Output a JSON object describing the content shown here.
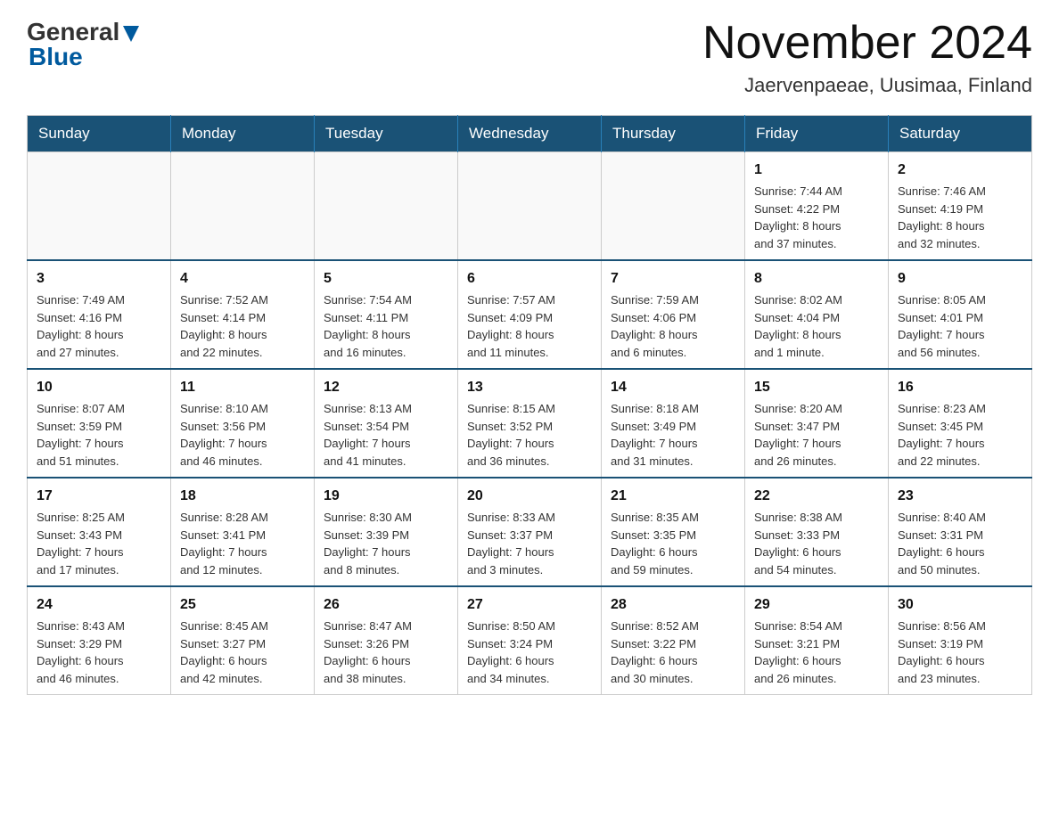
{
  "header": {
    "logo_general": "General",
    "logo_blue": "Blue",
    "month_title": "November 2024",
    "location": "Jaervenpaeae, Uusimaa, Finland"
  },
  "weekdays": [
    "Sunday",
    "Monday",
    "Tuesday",
    "Wednesday",
    "Thursday",
    "Friday",
    "Saturday"
  ],
  "weeks": [
    [
      {
        "day": "",
        "info": ""
      },
      {
        "day": "",
        "info": ""
      },
      {
        "day": "",
        "info": ""
      },
      {
        "day": "",
        "info": ""
      },
      {
        "day": "",
        "info": ""
      },
      {
        "day": "1",
        "info": "Sunrise: 7:44 AM\nSunset: 4:22 PM\nDaylight: 8 hours\nand 37 minutes."
      },
      {
        "day": "2",
        "info": "Sunrise: 7:46 AM\nSunset: 4:19 PM\nDaylight: 8 hours\nand 32 minutes."
      }
    ],
    [
      {
        "day": "3",
        "info": "Sunrise: 7:49 AM\nSunset: 4:16 PM\nDaylight: 8 hours\nand 27 minutes."
      },
      {
        "day": "4",
        "info": "Sunrise: 7:52 AM\nSunset: 4:14 PM\nDaylight: 8 hours\nand 22 minutes."
      },
      {
        "day": "5",
        "info": "Sunrise: 7:54 AM\nSunset: 4:11 PM\nDaylight: 8 hours\nand 16 minutes."
      },
      {
        "day": "6",
        "info": "Sunrise: 7:57 AM\nSunset: 4:09 PM\nDaylight: 8 hours\nand 11 minutes."
      },
      {
        "day": "7",
        "info": "Sunrise: 7:59 AM\nSunset: 4:06 PM\nDaylight: 8 hours\nand 6 minutes."
      },
      {
        "day": "8",
        "info": "Sunrise: 8:02 AM\nSunset: 4:04 PM\nDaylight: 8 hours\nand 1 minute."
      },
      {
        "day": "9",
        "info": "Sunrise: 8:05 AM\nSunset: 4:01 PM\nDaylight: 7 hours\nand 56 minutes."
      }
    ],
    [
      {
        "day": "10",
        "info": "Sunrise: 8:07 AM\nSunset: 3:59 PM\nDaylight: 7 hours\nand 51 minutes."
      },
      {
        "day": "11",
        "info": "Sunrise: 8:10 AM\nSunset: 3:56 PM\nDaylight: 7 hours\nand 46 minutes."
      },
      {
        "day": "12",
        "info": "Sunrise: 8:13 AM\nSunset: 3:54 PM\nDaylight: 7 hours\nand 41 minutes."
      },
      {
        "day": "13",
        "info": "Sunrise: 8:15 AM\nSunset: 3:52 PM\nDaylight: 7 hours\nand 36 minutes."
      },
      {
        "day": "14",
        "info": "Sunrise: 8:18 AM\nSunset: 3:49 PM\nDaylight: 7 hours\nand 31 minutes."
      },
      {
        "day": "15",
        "info": "Sunrise: 8:20 AM\nSunset: 3:47 PM\nDaylight: 7 hours\nand 26 minutes."
      },
      {
        "day": "16",
        "info": "Sunrise: 8:23 AM\nSunset: 3:45 PM\nDaylight: 7 hours\nand 22 minutes."
      }
    ],
    [
      {
        "day": "17",
        "info": "Sunrise: 8:25 AM\nSunset: 3:43 PM\nDaylight: 7 hours\nand 17 minutes."
      },
      {
        "day": "18",
        "info": "Sunrise: 8:28 AM\nSunset: 3:41 PM\nDaylight: 7 hours\nand 12 minutes."
      },
      {
        "day": "19",
        "info": "Sunrise: 8:30 AM\nSunset: 3:39 PM\nDaylight: 7 hours\nand 8 minutes."
      },
      {
        "day": "20",
        "info": "Sunrise: 8:33 AM\nSunset: 3:37 PM\nDaylight: 7 hours\nand 3 minutes."
      },
      {
        "day": "21",
        "info": "Sunrise: 8:35 AM\nSunset: 3:35 PM\nDaylight: 6 hours\nand 59 minutes."
      },
      {
        "day": "22",
        "info": "Sunrise: 8:38 AM\nSunset: 3:33 PM\nDaylight: 6 hours\nand 54 minutes."
      },
      {
        "day": "23",
        "info": "Sunrise: 8:40 AM\nSunset: 3:31 PM\nDaylight: 6 hours\nand 50 minutes."
      }
    ],
    [
      {
        "day": "24",
        "info": "Sunrise: 8:43 AM\nSunset: 3:29 PM\nDaylight: 6 hours\nand 46 minutes."
      },
      {
        "day": "25",
        "info": "Sunrise: 8:45 AM\nSunset: 3:27 PM\nDaylight: 6 hours\nand 42 minutes."
      },
      {
        "day": "26",
        "info": "Sunrise: 8:47 AM\nSunset: 3:26 PM\nDaylight: 6 hours\nand 38 minutes."
      },
      {
        "day": "27",
        "info": "Sunrise: 8:50 AM\nSunset: 3:24 PM\nDaylight: 6 hours\nand 34 minutes."
      },
      {
        "day": "28",
        "info": "Sunrise: 8:52 AM\nSunset: 3:22 PM\nDaylight: 6 hours\nand 30 minutes."
      },
      {
        "day": "29",
        "info": "Sunrise: 8:54 AM\nSunset: 3:21 PM\nDaylight: 6 hours\nand 26 minutes."
      },
      {
        "day": "30",
        "info": "Sunrise: 8:56 AM\nSunset: 3:19 PM\nDaylight: 6 hours\nand 23 minutes."
      }
    ]
  ]
}
